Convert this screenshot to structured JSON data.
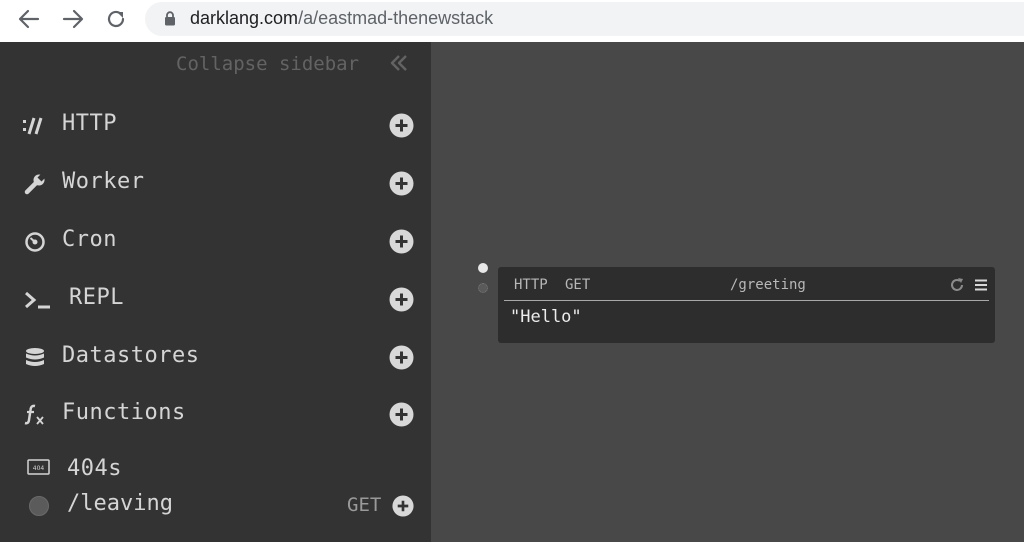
{
  "browser": {
    "url_host": "darklang.com",
    "url_path": "/a/eastmad-thenewstack"
  },
  "sidebar": {
    "collapse_label": "Collapse sidebar",
    "categories": [
      {
        "label": "HTTP",
        "icon": "http-icon"
      },
      {
        "label": "Worker",
        "icon": "wrench-icon"
      },
      {
        "label": "Cron",
        "icon": "cron-icon"
      },
      {
        "label": "REPL",
        "icon": "terminal-icon"
      },
      {
        "label": "Datastores",
        "icon": "database-icon"
      },
      {
        "label": "Functions",
        "icon": "function-icon"
      }
    ],
    "f404": {
      "label": "404s",
      "icon_text": "404",
      "entry_path": "/leaving",
      "entry_method": "GET"
    }
  },
  "handler": {
    "space": "HTTP",
    "modifier": "GET",
    "path": "/greeting",
    "body": "\"Hello\""
  },
  "colors": {
    "sidebar_bg": "#333333",
    "canvas_bg": "#484848",
    "handler_bg": "#2d2d2d",
    "text": "#d5d5d5"
  }
}
